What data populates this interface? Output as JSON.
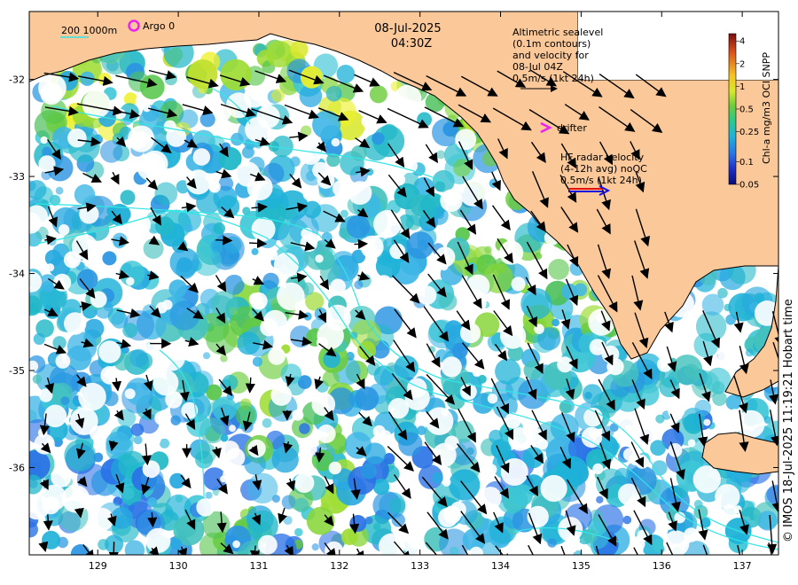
{
  "header": {
    "date": "08-Jul-2025",
    "time": "04:30Z"
  },
  "legend": {
    "isobath_label": "200  1000m",
    "argo_label": "Argo 0",
    "drifter_label": "drifter",
    "altimetry_lines": [
      "Altimetric sealevel",
      "(0.1m contours)",
      "and velocity for",
      "08-Jul 04Z",
      "0.5m/s (1kt 24h)"
    ],
    "hf_radar_lines": [
      "HF radar velocity",
      "(4-12h avg) noQC",
      "0.5m/s (1kt 24h)"
    ]
  },
  "colorbar": {
    "title": "Chl-a mg/m3 OCI SNPP",
    "ticks": [
      "4",
      "2",
      "1",
      "0.5",
      "0.25",
      "0.1",
      "0.05"
    ],
    "tick_values": [
      4,
      2,
      1,
      0.5,
      0.25,
      0.1,
      0.05
    ],
    "colors": [
      "#7a0d0d",
      "#d8501c",
      "#f5c425",
      "#d8e82c",
      "#6ccd3d",
      "#2dc88c",
      "#1fb2d8",
      "#2a72e6",
      "#1c2fc4",
      "#0b0b78"
    ]
  },
  "copyright": "© IMOS 18-Jul-2025 11:19:21 Hobart time",
  "axes": {
    "x_ticks": [
      "129",
      "130",
      "131",
      "132",
      "133",
      "134",
      "135",
      "136",
      "137"
    ],
    "x_values": [
      129,
      130,
      131,
      132,
      133,
      134,
      135,
      136,
      137
    ],
    "y_ticks": [
      "-32",
      "-33",
      "-34",
      "-35",
      "-36"
    ],
    "y_values": [
      -32,
      -33,
      -34,
      -35,
      -36
    ],
    "lon_range": [
      128.15,
      137.45
    ],
    "lat_range": [
      -36.9,
      -31.3
    ]
  },
  "colors": {
    "land": "#fbc899",
    "coast": "#000000",
    "isobath": "#33e5e5",
    "arrow": "#000000",
    "argo": "#ee22ee",
    "drifter": "#ee22ee",
    "hf_red": "#e01010",
    "hf_blue": "#1010e0",
    "chl_mid": "#1fb2d8",
    "chl_green": "#6ccd3d",
    "chl_yellow": "#d8e82c"
  }
}
